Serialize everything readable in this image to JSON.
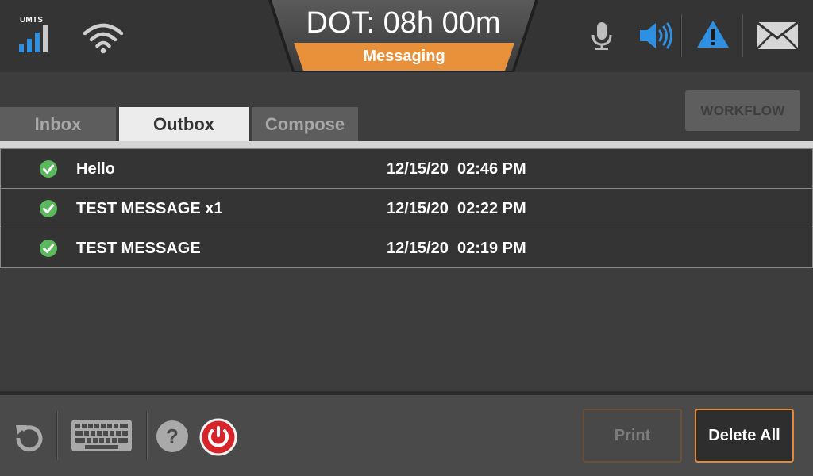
{
  "status": {
    "network_label": "UMTS",
    "signal_icon": "signal-bars-icon",
    "wifi_icon": "wifi-icon"
  },
  "header": {
    "dot_timer": "DOT: 08h 00m",
    "section": "Messaging"
  },
  "top_icons": [
    "microphone-icon",
    "speaker-icon",
    "warning-icon",
    "mail-icon"
  ],
  "workflow_label": "WORKFLOW",
  "tabs": [
    {
      "label": "Inbox",
      "active": false
    },
    {
      "label": "Outbox",
      "active": true
    },
    {
      "label": "Compose",
      "active": false
    }
  ],
  "messages": [
    {
      "subject": "Hello",
      "date": "12/15/20  02:46 PM",
      "status": "sent"
    },
    {
      "subject": "TEST MESSAGE x1",
      "date": "12/15/20  02:22 PM",
      "status": "sent"
    },
    {
      "subject": "TEST MESSAGE",
      "date": "12/15/20  02:19 PM",
      "status": "sent"
    }
  ],
  "footer": {
    "icons": [
      "refresh-icon",
      "keyboard-icon",
      "help-icon",
      "power-icon"
    ],
    "print_label": "Print",
    "delete_all_label": "Delete All"
  },
  "colors": {
    "accent_orange": "#e8903a",
    "accent_blue": "#2f8fe0",
    "check_green": "#5cb85c",
    "power_red": "#d9232a"
  }
}
